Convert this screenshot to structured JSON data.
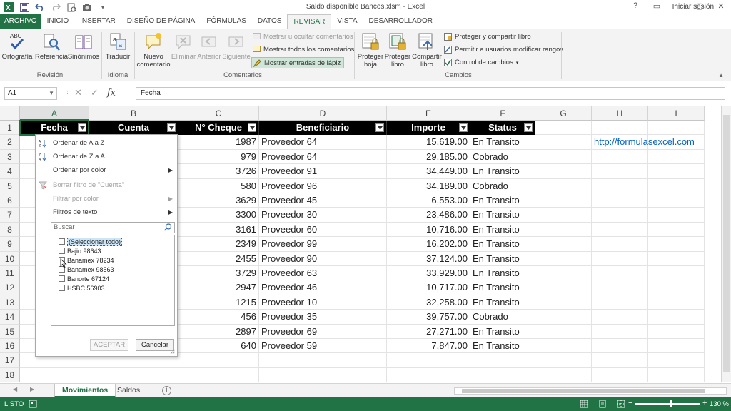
{
  "window": {
    "title": "Saldo disponible Bancos.xlsm - Excel",
    "signin": "Iniciar sesión",
    "controls": [
      "?",
      "▭",
      "—",
      "▢",
      "✕"
    ]
  },
  "tabs": [
    {
      "label": "ARCHIVO"
    },
    {
      "label": "INICIO"
    },
    {
      "label": "INSERTAR"
    },
    {
      "label": "DISEÑO DE PÁGINA"
    },
    {
      "label": "FÓRMULAS"
    },
    {
      "label": "DATOS"
    },
    {
      "label": "REVISAR"
    },
    {
      "label": "VISTA"
    },
    {
      "label": "DESARROLLADOR"
    }
  ],
  "ribbon": {
    "revision": {
      "label": "Revisión",
      "ortografia": "Ortografía",
      "referencia": "Referencia",
      "sinonimos": "Sinónimos",
      "abc": "ABC"
    },
    "idioma": {
      "label": "Idioma",
      "traducir": "Traducir"
    },
    "comentarios": {
      "label": "Comentarios",
      "nuevo1": "Nuevo",
      "nuevo2": "comentario",
      "eliminar": "Eliminar",
      "anterior": "Anterior",
      "siguiente": "Siguiente",
      "mostrar_ocultar": "Mostrar u ocultar comentarios",
      "mostrar_todos": "Mostrar todos los comentarios",
      "mostrar_lapiz": "Mostrar entradas de lápiz"
    },
    "cambios": {
      "label": "Cambios",
      "proteger_hoja1": "Proteger",
      "proteger_hoja2": "hoja",
      "proteger_libro1": "Proteger",
      "proteger_libro2": "libro",
      "compartir_libro1": "Compartir",
      "compartir_libro2": "libro",
      "proteger_compartir": "Proteger y compartir libro",
      "permitir": "Permitir a usuarios modificar rangos",
      "control": "Control de cambios"
    }
  },
  "formula_bar": {
    "namebox": "A1",
    "value": "Fecha",
    "fx": "fx",
    "cancel": "✕",
    "enter": "✓"
  },
  "columns": [
    "A",
    "B",
    "C",
    "D",
    "E",
    "F",
    "G",
    "H",
    "I"
  ],
  "rows": [
    "1",
    "2",
    "3",
    "4",
    "5",
    "6",
    "7",
    "8",
    "9",
    "10",
    "11",
    "12",
    "13",
    "14",
    "15",
    "16",
    "17",
    "18"
  ],
  "table": {
    "headers": [
      "Fecha",
      "Cuenta",
      "N° Cheque",
      "Beneficiario",
      "Importe",
      "Status"
    ],
    "rows": [
      [
        "1987",
        "Proveedor 64",
        "15,619.00",
        "En Transito"
      ],
      [
        "979",
        "Proveedor 64",
        "29,185.00",
        "Cobrado"
      ],
      [
        "3726",
        "Proveedor 91",
        "34,449.00",
        "En Transito"
      ],
      [
        "580",
        "Proveedor 96",
        "34,189.00",
        "Cobrado"
      ],
      [
        "3629",
        "Proveedor 45",
        "6,553.00",
        "En Transito"
      ],
      [
        "3300",
        "Proveedor 30",
        "23,486.00",
        "En Transito"
      ],
      [
        "3161",
        "Proveedor 60",
        "10,716.00",
        "En Transito"
      ],
      [
        "2349",
        "Proveedor 99",
        "16,202.00",
        "En Transito"
      ],
      [
        "2455",
        "Proveedor 90",
        "37,124.00",
        "En Transito"
      ],
      [
        "3729",
        "Proveedor 63",
        "33,929.00",
        "En Transito"
      ],
      [
        "2947",
        "Proveedor 46",
        "10,717.00",
        "En Transito"
      ],
      [
        "1215",
        "Proveedor 10",
        "32,258.00",
        "En Transito"
      ],
      [
        "456",
        "Proveedor 35",
        "39,757.00",
        "Cobrado"
      ],
      [
        "2897",
        "Proveedor 69",
        "27,271.00",
        "En Transito"
      ],
      [
        "640",
        "Proveedor 59",
        "7,847.00",
        "En Transito"
      ]
    ],
    "link": "http://formulasexcel.com"
  },
  "filter_menu": {
    "sort_az": "Ordenar de A a Z",
    "sort_za": "Ordenar de Z a A",
    "sort_color": "Ordenar por color",
    "clear_filter": "Borrar filtro de \"Cuenta\"",
    "filter_color": "Filtrar por color",
    "text_filters": "Filtros de texto",
    "search_placeholder": "Buscar",
    "items": [
      "(Seleccionar todo)",
      "Bajio 98643",
      "Banamex 78234",
      "Banamex 98563",
      "Banorte 67124",
      "HSBC 56903"
    ],
    "ok": "ACEPTAR",
    "cancel": "Cancelar"
  },
  "sheets": {
    "active": "Movimientos",
    "other": "Saldos",
    "add": "+"
  },
  "status": {
    "ready": "LISTO",
    "zoom": "130 %",
    "zoom_value_percent": 130,
    "zoom_minus": "−",
    "zoom_plus": "+"
  }
}
